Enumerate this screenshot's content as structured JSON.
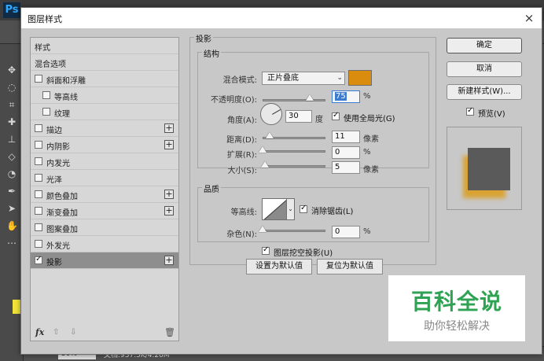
{
  "app": {
    "logo": "Ps",
    "zoom": "50%",
    "doc_info": "文档:937.5K/4.26M"
  },
  "dialog": {
    "title": "图层样式",
    "close": "×"
  },
  "list": {
    "items": [
      {
        "label": "样式"
      },
      {
        "label": "混合选项"
      },
      {
        "label": "斜面和浮雕"
      },
      {
        "label": "等高线"
      },
      {
        "label": "纹理"
      },
      {
        "label": "描边"
      },
      {
        "label": "内阴影"
      },
      {
        "label": "内发光"
      },
      {
        "label": "光泽"
      },
      {
        "label": "颜色叠加"
      },
      {
        "label": "渐变叠加"
      },
      {
        "label": "图案叠加"
      },
      {
        "label": "外发光"
      },
      {
        "label": "投影"
      }
    ],
    "plus": "+",
    "fx": "fx",
    "up": "⇧",
    "down": "⇩",
    "trash": "🗑"
  },
  "drop_shadow": {
    "section": "投影",
    "structure": "结构",
    "blend_mode_label": "混合模式:",
    "blend_mode": "正片叠底",
    "shadow_color": "#d98c0d",
    "opacity_label": "不透明度(O):",
    "opacity": "75",
    "opacity_unit": "%",
    "opacity_pct": 75,
    "angle_label": "角度(A):",
    "angle": "30",
    "angle_unit": "度",
    "global_light": "使用全局光(G)",
    "distance_label": "距离(D):",
    "distance": "11",
    "distance_unit": "像素",
    "spread_label": "扩展(R):",
    "spread": "0",
    "spread_unit": "%",
    "size_label": "大小(S):",
    "size": "5",
    "size_unit": "像素",
    "quality": "品质",
    "contour_label": "等高线:",
    "anti_alias": "消除锯齿(L)",
    "noise_label": "杂色(N):",
    "noise": "0",
    "noise_unit": "%",
    "knockout": "图层挖空投影(U)",
    "set_default": "设置为默认值",
    "reset_default": "复位为默认值"
  },
  "right": {
    "ok": "确定",
    "cancel": "取消",
    "new_style": "新建样式(W)...",
    "preview": "预览(V)"
  },
  "watermark": {
    "main": "百科全说",
    "sub": "助你轻松解决"
  }
}
